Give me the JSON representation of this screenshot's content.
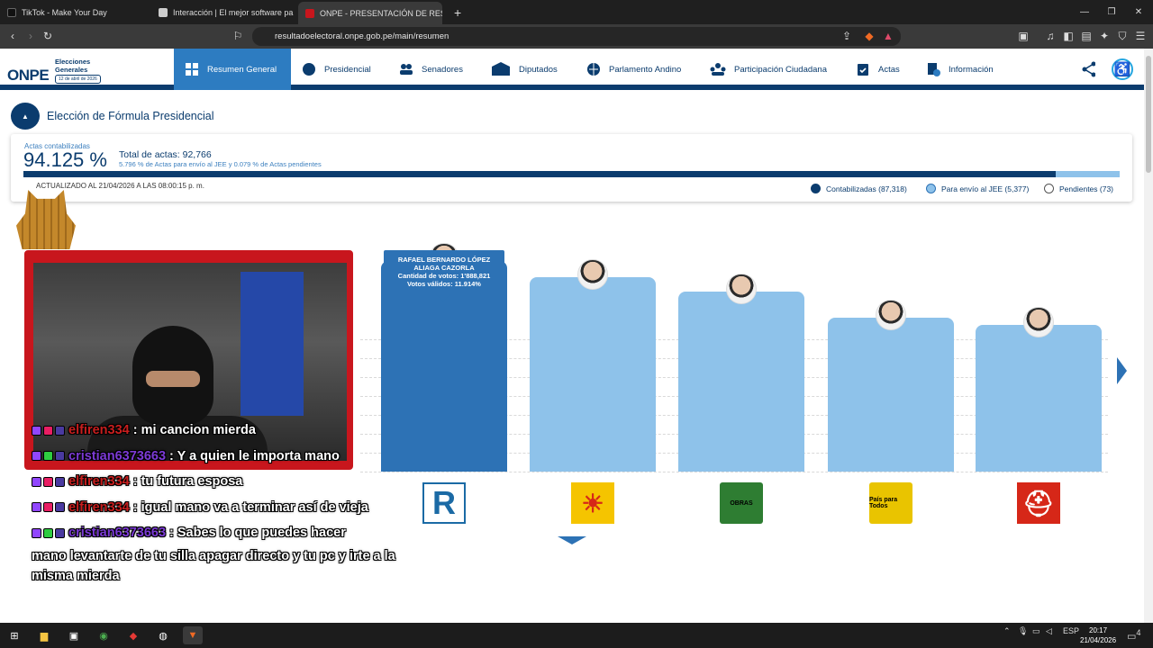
{
  "browser": {
    "tabs": [
      {
        "label": "TikTok - Make Your Day",
        "favicon_color": "#111111"
      },
      {
        "label": "Interacción | El mejor software pa",
        "favicon_color": "#cccccc"
      },
      {
        "label": "ONPE - PRESENTACIÓN DE RESU",
        "favicon_color": "#c8161d",
        "close": "✕"
      }
    ],
    "new_tab": "+",
    "url": "resultadoelectoral.onpe.gob.pe/main/resumen",
    "window_controls": [
      "—",
      "❐",
      "✕"
    ]
  },
  "site": {
    "logo_text": "ONPE",
    "logo_subtitle_1": "Elecciones",
    "logo_subtitle_2": "Generales",
    "logo_date": "12 de abril de 2026",
    "nav": [
      {
        "label": "Resumen General",
        "icon": "grid-icon",
        "active": true
      },
      {
        "label": "Presidencial",
        "icon": "seal-icon"
      },
      {
        "label": "Senadores",
        "icon": "people-icon"
      },
      {
        "label": "Diputados",
        "icon": "building-icon"
      },
      {
        "label": "Parlamento Andino",
        "icon": "globe-icon"
      },
      {
        "label": "Participación Ciudadana",
        "icon": "group-icon"
      },
      {
        "label": "Actas",
        "icon": "clipboard-icon"
      },
      {
        "label": "Información",
        "icon": "info-doc-icon"
      }
    ]
  },
  "section": {
    "title": "Elección de Fórmula Presidencial"
  },
  "summary": {
    "label": "Actas contabilizadas",
    "percent": "94.125 %",
    "total": "Total de actas: 92,766",
    "sub": "5.796 % de Actas para envío al JEE y 0.079 % de Actas pendientes",
    "progress_counted": 0.94125,
    "updated": "ACTUALIZADO AL 21/04/2026 A LAS 08:00:15 p. m.",
    "legend": [
      {
        "label": "Contabilizadas (87,318)",
        "color": "#0b3c6e"
      },
      {
        "label": "Para envío al JEE (5,377)",
        "color": "#8ec2ea"
      },
      {
        "label": "Pendientes (73)",
        "color": "#ffffff"
      }
    ]
  },
  "tooltip": {
    "name_1": "RAFAEL BERNARDO LÓPEZ",
    "name_2": "ALIAGA CAZORLA",
    "votes": "Cantidad de votos: 1'888,821",
    "valid": "Votos válidos: 11.914%"
  },
  "candidates": [
    {
      "party": "R",
      "party_color": "#1b6aa5",
      "valid_pct": 11.914,
      "selected": true
    },
    {
      "party": "☀",
      "party_color": "#d62718",
      "valid_pct": 11.0
    },
    {
      "party": "OBRAS",
      "party_color": "#2e7d32",
      "valid_pct": 10.2
    },
    {
      "party": "País para Todos",
      "party_color": "#e9c400",
      "valid_pct": 8.7
    },
    {
      "party": "⛑",
      "party_color": "#d62718",
      "valid_pct": 8.3
    }
  ],
  "chat": [
    {
      "user": "elfiren334",
      "msg": ": mi cancion mierda",
      "purple": false
    },
    {
      "user": "cristian6373663",
      "msg": ": Y a quien le importa mano",
      "purple": true
    },
    {
      "user": "elfiren334",
      "msg": ": tu futura esposa",
      "purple": false
    },
    {
      "user": "elfiren334",
      "msg": ": igual mano va a terminar así de vieja",
      "purple": false
    },
    {
      "user": "cristian6373663",
      "msg": ": Sabes lo que puedes hacer",
      "purple": true
    }
  ],
  "chat_continuation_1": "mano levantarte de tu silla apagar directo y tu pc y irte a la",
  "chat_continuation_2": "misma mierda",
  "taskbar": {
    "lang": "ESP",
    "time": "20:17",
    "date": "21/04/2026",
    "notif": "4"
  }
}
